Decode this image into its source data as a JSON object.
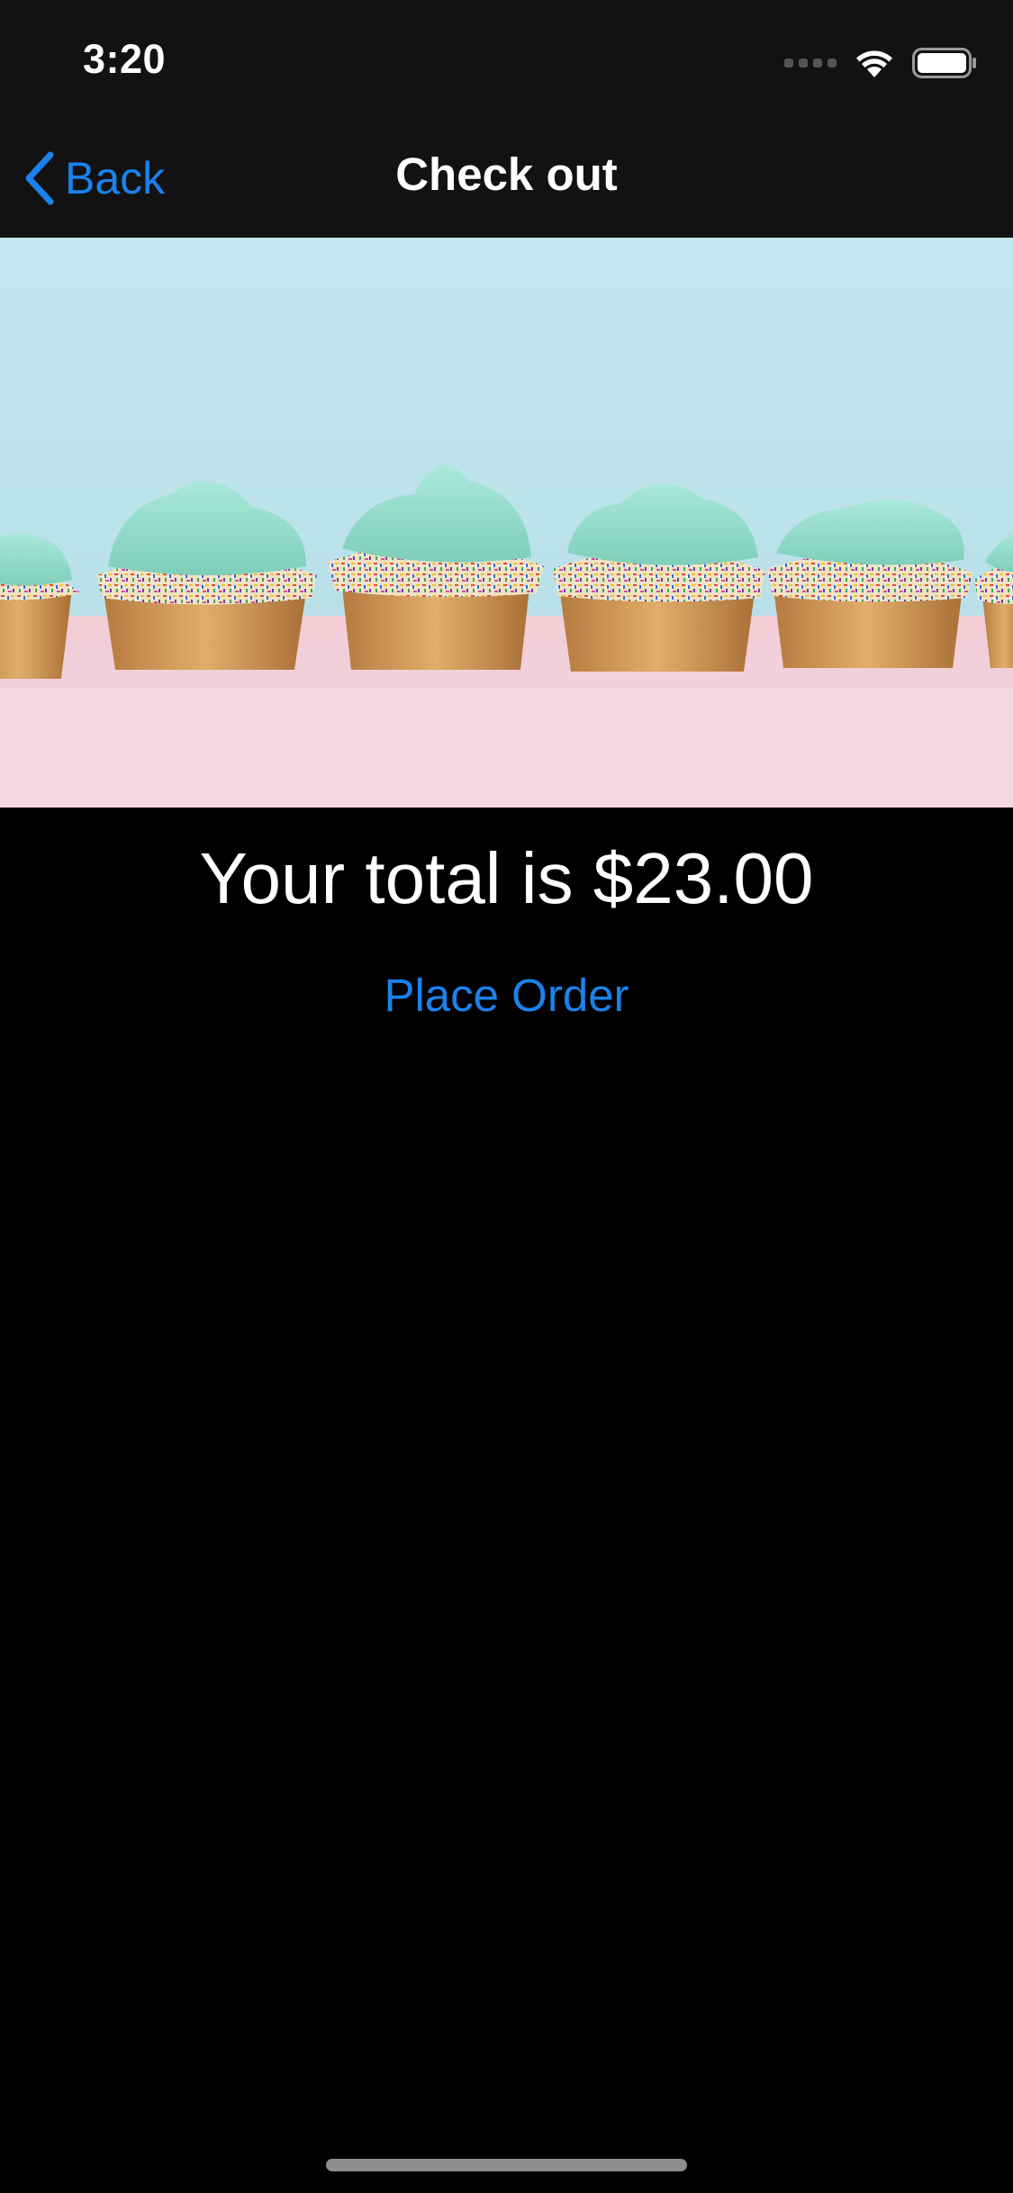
{
  "status_bar": {
    "time": "3:20"
  },
  "nav": {
    "back_label": "Back",
    "title": "Check out"
  },
  "hero": {
    "subject": "cupcakes with mint frosting and rainbow sprinkles"
  },
  "content": {
    "total_text": "Your total is $23.00",
    "place_order_label": "Place Order"
  },
  "colors": {
    "accent": "#1a82ec",
    "background": "#000000",
    "bar_background": "#121212",
    "frosting": "#8fd9c7",
    "sky": "#bfe3ea",
    "table": "#f2cfd9"
  },
  "icons": {
    "back": "chevron-left-icon",
    "wifi": "wifi-icon",
    "battery": "battery-icon",
    "signal": "cellular-signal-icon"
  }
}
